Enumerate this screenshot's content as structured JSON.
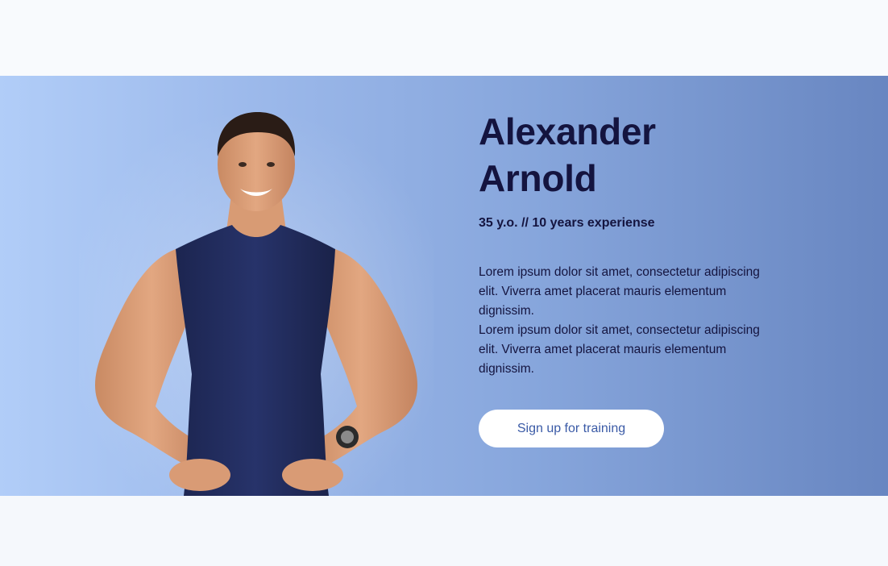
{
  "trainer": {
    "first_name": "Alexander",
    "last_name": "Arnold",
    "meta": "35 y.o. // 10 years experiense",
    "description": [
      "Lorem ipsum dolor sit amet, consectetur adipiscing elit. Viverra amet placerat mauris elementum dignissim.",
      "Lorem ipsum dolor sit amet, consectetur adipiscing elit. Viverra amet placerat mauris elementum dignissim."
    ],
    "cta_label": "Sign up for training"
  },
  "colors": {
    "name_text": "#14143f",
    "button_text": "#3a5aa6",
    "hero_gradient_start": "#b1cdf8",
    "hero_gradient_end": "#6886c1"
  }
}
